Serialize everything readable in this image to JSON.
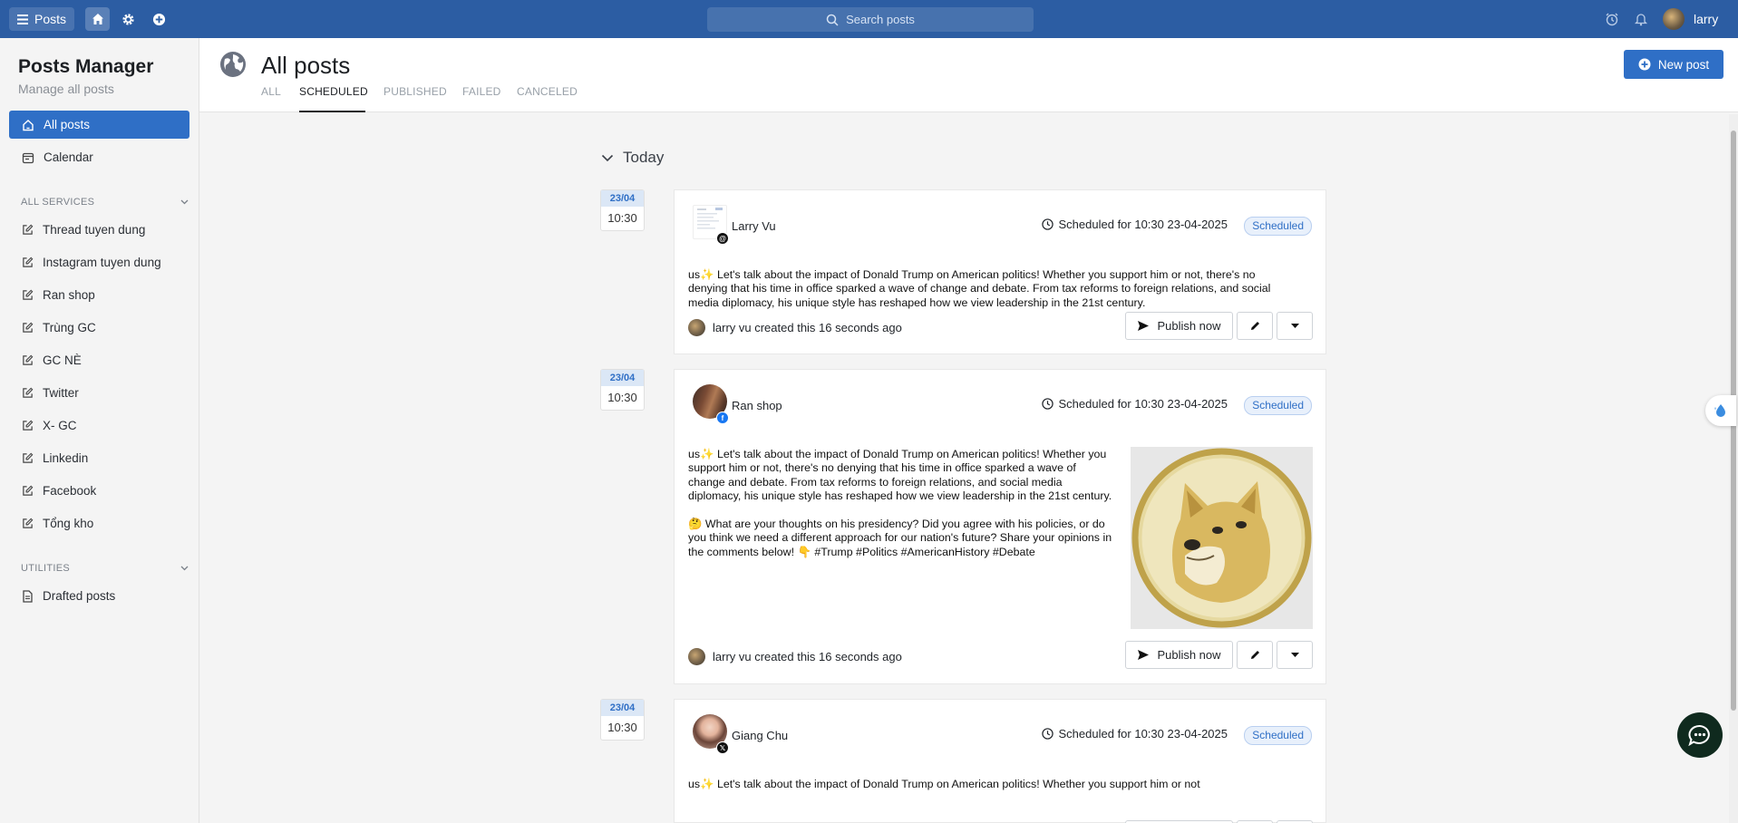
{
  "topbar": {
    "posts_label": "Posts",
    "search_placeholder": "Search posts",
    "user_name": "larry"
  },
  "sidebar": {
    "title": "Posts Manager",
    "subtitle": "Manage all posts",
    "nav": [
      {
        "label": "All posts",
        "icon": "home-icon",
        "active": true
      },
      {
        "label": "Calendar",
        "icon": "calendar-icon",
        "active": false
      }
    ],
    "services_heading": "ALL SERVICES",
    "services": [
      {
        "label": "Thread tuyen dung"
      },
      {
        "label": "Instagram tuyen dung"
      },
      {
        "label": "Ran shop"
      },
      {
        "label": "Trùng GC"
      },
      {
        "label": "GC NÈ"
      },
      {
        "label": "Twitter"
      },
      {
        "label": "X- GC"
      },
      {
        "label": "Linkedin"
      },
      {
        "label": "Facebook"
      },
      {
        "label": "Tổng kho"
      }
    ],
    "utilities_heading": "UTILITIES",
    "utilities": [
      {
        "label": "Drafted posts"
      }
    ]
  },
  "header": {
    "title": "All posts",
    "tabs": [
      {
        "label": "ALL",
        "active": false
      },
      {
        "label": "SCHEDULED",
        "active": true
      },
      {
        "label": "PUBLISHED",
        "active": false
      },
      {
        "label": "FAILED",
        "active": false
      },
      {
        "label": "CANCELED",
        "active": false
      }
    ],
    "new_post_label": "New post"
  },
  "group": {
    "label": "Today"
  },
  "posts": [
    {
      "date": "23/04",
      "time": "10:30",
      "account": "Larry Vu",
      "network": "threads",
      "scheduled_text": "Scheduled for 10:30 23-04-2025",
      "status": "Scheduled",
      "text_lines": [
        "us✨ Let's talk about the impact of Donald Trump on American politics! Whether you support him or not, there's no",
        "denying that his time in office sparked a wave of change and debate. From tax reforms to foreign relations, and social",
        "media diplomacy, his unique style has reshaped how we view leadership in the 21st century."
      ],
      "creator_text": "larry vu created this 16 seconds ago",
      "publish_label": "Publish now"
    },
    {
      "date": "23/04",
      "time": "10:30",
      "account": "Ran shop",
      "network": "facebook",
      "scheduled_text": "Scheduled for 10:30 23-04-2025",
      "status": "Scheduled",
      "text_lines": [
        "us✨ Let's talk about the impact of Donald Trump on American politics! Whether you",
        "support him or not, there's no denying that his time in office sparked a wave of",
        "change and debate. From tax reforms to foreign relations, and social media",
        "diplomacy, his unique style has reshaped how we view leadership in the 21st century.",
        "",
        "🤔 What are your thoughts on his presidency? Did you agree with his policies, or do",
        "you think we need a different approach for our nation's future? Share your opinions in",
        "the comments below! 👇 #Trump #Politics #AmericanHistory #Debate"
      ],
      "creator_text": "larry vu created this 16 seconds ago",
      "publish_label": "Publish now"
    },
    {
      "date": "23/04",
      "time": "10:30",
      "account": "Giang Chu",
      "network": "x",
      "scheduled_text": "Scheduled for 10:30 23-04-2025",
      "status": "Scheduled",
      "text_lines": [
        "us✨ Let's talk about the impact of Donald Trump on American politics! Whether you support him or not"
      ]
    }
  ]
}
